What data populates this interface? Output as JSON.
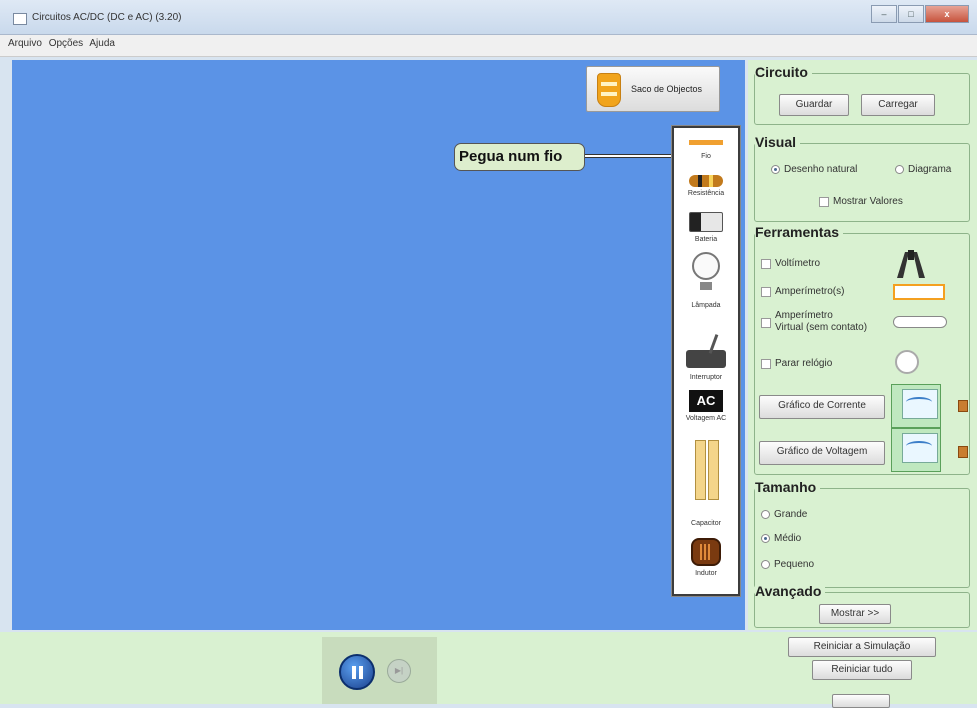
{
  "window": {
    "title": "Circuitos AC/DC (DC e AC) (3.20)",
    "min": "–",
    "max": "□",
    "close": "x"
  },
  "menu": [
    "Arquivo",
    "Opções",
    "Ajuda"
  ],
  "sack_label": "Saco de Objectos",
  "callout": "Pegua num fio",
  "toolbox": [
    "Fio",
    "Resistência",
    "Bateria",
    "Lâmpada",
    "Interruptor",
    "Voltagem AC",
    "Capacitor",
    "Indutor"
  ],
  "ac_glyph": "AC",
  "circuit": {
    "title": "Circuito",
    "save": "Guardar",
    "load": "Carregar"
  },
  "visual": {
    "title": "Visual",
    "natural": "Desenho natural",
    "diagram": "Diagrama",
    "show_values": "Mostrar Valores"
  },
  "tools": {
    "title": "Ferramentas",
    "voltmeter": "Voltímetro",
    "ammeter": "Amperímetro(s)",
    "virtual_1": "Amperímetro",
    "virtual_2": "Virtual (sem contato)",
    "stopwatch": "Parar relógio",
    "current_chart": "Gráfico de Corrente",
    "voltage_chart": "Gráfico de Voltagem"
  },
  "size": {
    "title": "Tamanho",
    "large": "Grande",
    "medium": "Médio",
    "small": "Pequeno"
  },
  "advanced": {
    "title": "Avançado",
    "show": "Mostrar >>"
  },
  "bottom": {
    "reset_sim": "Reiniciar a Simulação",
    "reset_all": "Reiniciar tudo"
  },
  "colors": {
    "canvas": "#5b93e6",
    "panel": "#d9f1d1"
  }
}
